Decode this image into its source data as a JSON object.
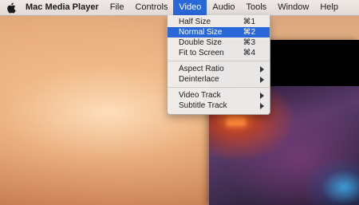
{
  "menubar": {
    "apple_icon": "apple-icon",
    "app_name": "Mac Media Player",
    "menus": [
      "File",
      "Controls",
      "Video",
      "Audio",
      "Tools",
      "Window",
      "Help"
    ],
    "active_menu": "Video"
  },
  "video_menu": {
    "items": [
      {
        "label": "Half Size",
        "shortcut": "⌘1"
      },
      {
        "label": "Normal Size",
        "shortcut": "⌘2",
        "selected": true
      },
      {
        "label": "Double Size",
        "shortcut": "⌘3"
      },
      {
        "label": "Fit to Screen",
        "shortcut": "⌘4"
      }
    ],
    "submenus_a": [
      {
        "label": "Aspect Ratio"
      },
      {
        "label": "Deinterlace"
      }
    ],
    "submenus_b": [
      {
        "label": "Video Track"
      },
      {
        "label": "Subtitle Track"
      }
    ]
  },
  "colors": {
    "highlight": "#2a68d8",
    "menubar": "#ece8e6"
  }
}
